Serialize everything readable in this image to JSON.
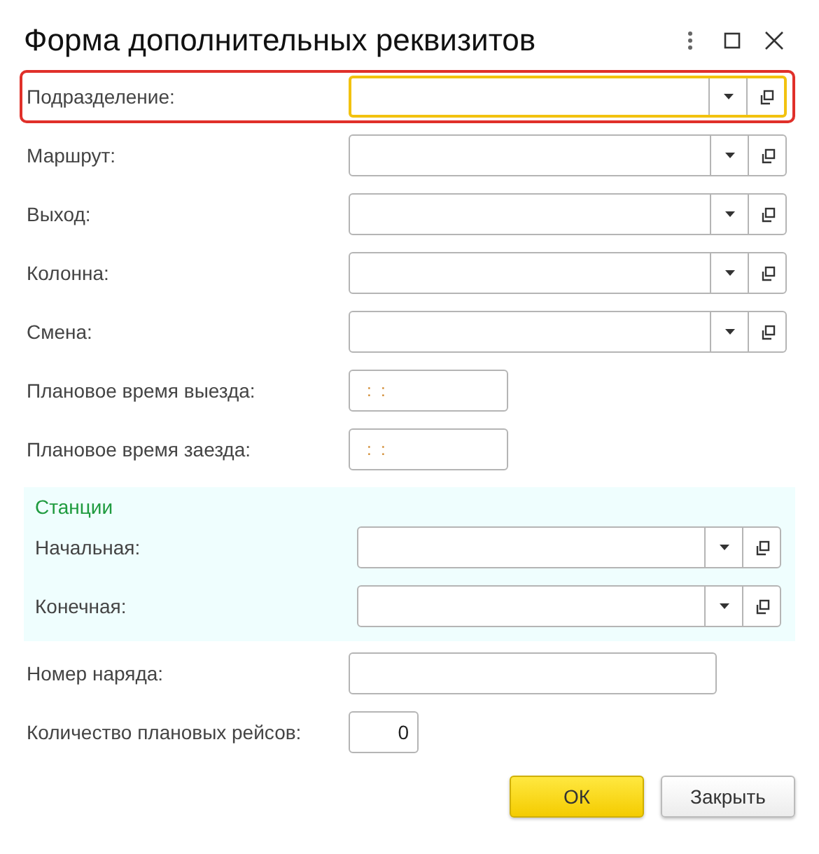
{
  "window": {
    "title": "Форма дополнительных реквизитов"
  },
  "fields": [
    {
      "kind": "select",
      "label": "Подразделение:",
      "focused": true,
      "highlighted": true
    },
    {
      "kind": "select",
      "label": "Маршрут:",
      "focused": false,
      "highlighted": false
    },
    {
      "kind": "select",
      "label": "Выход:",
      "focused": false,
      "highlighted": false
    },
    {
      "kind": "select",
      "label": "Колонна:",
      "focused": false,
      "highlighted": false
    },
    {
      "kind": "select",
      "label": "Смена:",
      "focused": false,
      "highlighted": false
    },
    {
      "kind": "time",
      "label": "Плановое время выезда:",
      "mask": ":  :",
      "focused": false,
      "highlighted": false
    },
    {
      "kind": "time",
      "label": "Плановое время заезда:",
      "mask": ":  :",
      "focused": false,
      "highlighted": false
    }
  ],
  "stations": {
    "title": "Станции",
    "fields": [
      {
        "kind": "select",
        "label": "Начальная:",
        "focused": false,
        "highlighted": false
      },
      {
        "kind": "select",
        "label": "Конечная:",
        "focused": false,
        "highlighted": false
      }
    ]
  },
  "fields_after": [
    {
      "kind": "text",
      "label": "Номер наряда:",
      "focused": false,
      "highlighted": false
    },
    {
      "kind": "number",
      "label": "Количество плановых рейсов:",
      "value": "0",
      "focused": false,
      "highlighted": false
    }
  ],
  "buttons": [
    {
      "label": "ОК",
      "kind": "default"
    },
    {
      "label": "Закрыть",
      "kind": "normal"
    }
  ]
}
